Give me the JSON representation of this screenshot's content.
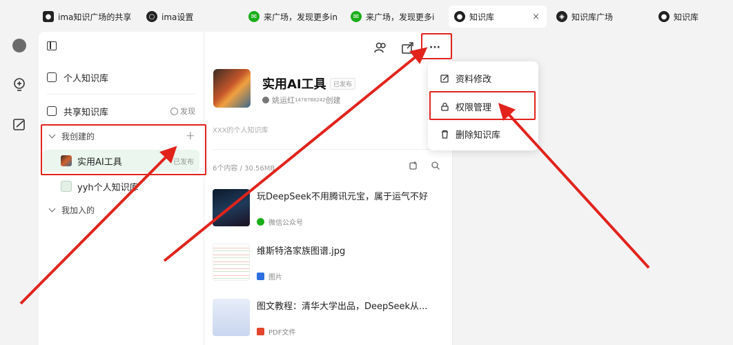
{
  "tabs": [
    {
      "label": "ima知识广场的共享",
      "icon": "panda-icon"
    },
    {
      "label": "ima设置",
      "icon": "gear-icon"
    },
    {
      "label": "来广场，发现更多in",
      "icon": "wechat-icon"
    },
    {
      "label": "来广场，发现更多i",
      "icon": "wechat-icon"
    },
    {
      "label": "知识库",
      "icon": "bulb-icon",
      "close": "×"
    },
    {
      "label": "知识库广场",
      "icon": "compass-icon"
    },
    {
      "label": "知识库",
      "icon": "bulb-icon"
    }
  ],
  "sidebar": {
    "personal": "个人知识库",
    "shared": "共享知识库",
    "discover": "发现",
    "created_group": "我创建的",
    "add": "+",
    "items": [
      {
        "label": "实用AI工具",
        "badge": "已发布"
      },
      {
        "label": "yyh个人知识库"
      }
    ],
    "joined_group": "我加入的"
  },
  "detail": {
    "title": "实用AI工具",
    "published": "已发布",
    "creator_name": "姚运红",
    "creator_id": "147878",
    "creator_suffix": "8242",
    "created": "创建",
    "description": "XXX的个人知识库",
    "count": "6个内容 / 30.56MB",
    "more": "···",
    "items": [
      {
        "title": "玩DeepSeek不用腾讯元宝，属于运气不好",
        "source": "微信公众号"
      },
      {
        "title": "维斯特洛家族图谱.jpg",
        "source": "图片"
      },
      {
        "title": "图文教程：清华大学出品，DeepSeek从...",
        "source": "PDF文件"
      }
    ]
  },
  "menu": {
    "items": [
      "资料修改",
      "权限管理",
      "删除知识库"
    ]
  },
  "colors": {
    "highlight": "#e1231c",
    "selected_bg": "#eaf6ee",
    "wechat": "#1aad19"
  }
}
